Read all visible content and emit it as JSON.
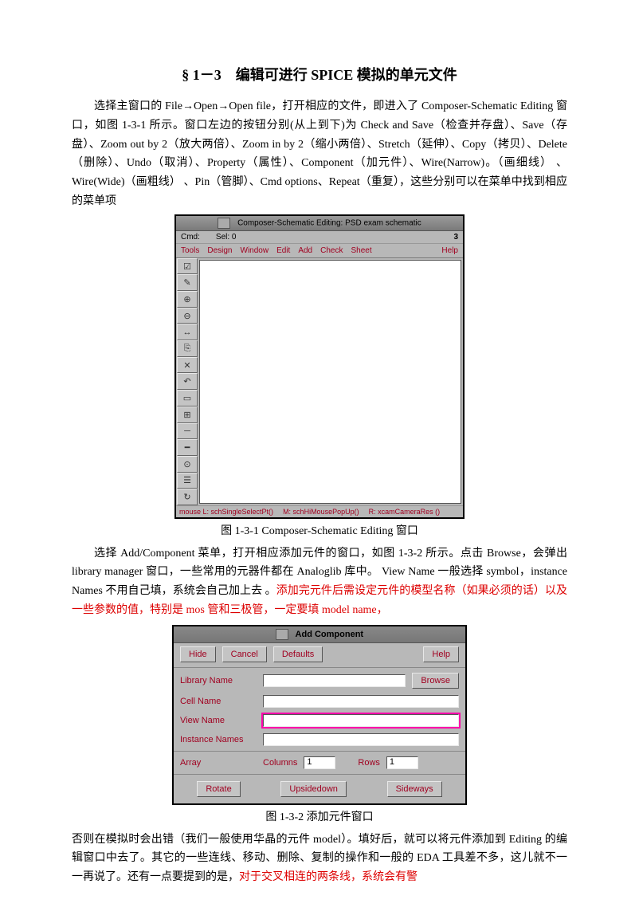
{
  "section_title": "§ 1－3　编辑可进行 SPICE 模拟的单元文件",
  "para1": "选择主窗口的 File→Open→Open file，打开相应的文件，即进入了 Composer-Schematic Editing 窗口，如图 1-3-1 所示。窗口左边的按钮分别(从上到下)为 Check and Save（检查并存盘）、Save（存盘）、Zoom out by 2（放大两倍）、Zoom in by 2（缩小两倍）、Stretch（延伸）、Copy（拷贝）、Delete（删除）、Undo（取消）、Property（属性）、Component（加元件）、Wire(Narrow)。（画细线） 、Wire(Wide)（画粗线） 、Pin（管脚）、Cmd options、Repeat（重复），这些分别可以在菜单中找到相应的菜单项",
  "fig1": {
    "title": "Composer-Schematic Editing: PSD exam schematic",
    "cmd_label": "Cmd:",
    "sel_label": "Sel: 0",
    "count": "3",
    "menus": [
      "Tools",
      "Design",
      "Window",
      "Edit",
      "Add",
      "Check",
      "Sheet"
    ],
    "help": "Help",
    "tool_icons": [
      "check-save-icon",
      "save-icon",
      "zoom-out-icon",
      "zoom-in-icon",
      "stretch-icon",
      "copy-icon",
      "delete-icon",
      "undo-icon",
      "property-icon",
      "component-icon",
      "wire-narrow-icon",
      "wire-wide-icon",
      "pin-icon",
      "cmd-options-icon",
      "repeat-icon"
    ],
    "tool_glyphs": [
      "☑",
      "✎",
      "⊕",
      "⊖",
      "↔",
      "⎘",
      "✕",
      "↶",
      "▭",
      "⊞",
      "─",
      "━",
      "⊙",
      "☰",
      "↻"
    ],
    "status": {
      "mouse": "mouse L: schSingleSelectPt()",
      "mid": "M: schHiMousePopUp()",
      "right": "R: xcamCameraRes ()"
    }
  },
  "caption1": "图  1-3-1    Composer-Schematic Editing 窗口",
  "para2a": "选择 Add/Component 菜单，打开相应添加元件的窗口，如图 1-3-2 所示。点击 Browse，会弹出 library manager 窗口，一些常用的元器件都在 Analoglib 库中。 View Name 一般选择 symbol，instance Names 不用自己填，系统会自己加上去 。",
  "para2b_red": "添加完元件后需设定元件的模型名称（如果必须的话）以及一些参数的值，特别是 mos 管和三极管，一定要填 model name，",
  "fig2": {
    "title": "Add Component",
    "buttons_top": {
      "hide": "Hide",
      "cancel": "Cancel",
      "defaults": "Defaults",
      "help": "Help"
    },
    "labels": {
      "library": "Library Name",
      "cell": "Cell Name",
      "view": "View Name",
      "instance": "Instance Names",
      "array": "Array",
      "columns": "Columns",
      "rows": "Rows"
    },
    "values": {
      "columns": "1",
      "rows": "1"
    },
    "browse": "Browse",
    "buttons_bottom": {
      "rotate": "Rotate",
      "upsidedown": "Upsidedown",
      "sideways": "Sideways"
    }
  },
  "caption2": "图  1-3-2    添加元件窗口",
  "para3a": "否则在模拟时会出错（我们一般使用华晶的元件 model）。填好后，就可以将元件添加到 Editing 的编辑窗口中去了。其它的一些连线、移动、删除、复制的操作和一般的 EDA 工具差不多，这儿就不一一再说了。还有一点要提到的是，",
  "para3b_red": "对于交叉相连的两条线，系统会有警"
}
